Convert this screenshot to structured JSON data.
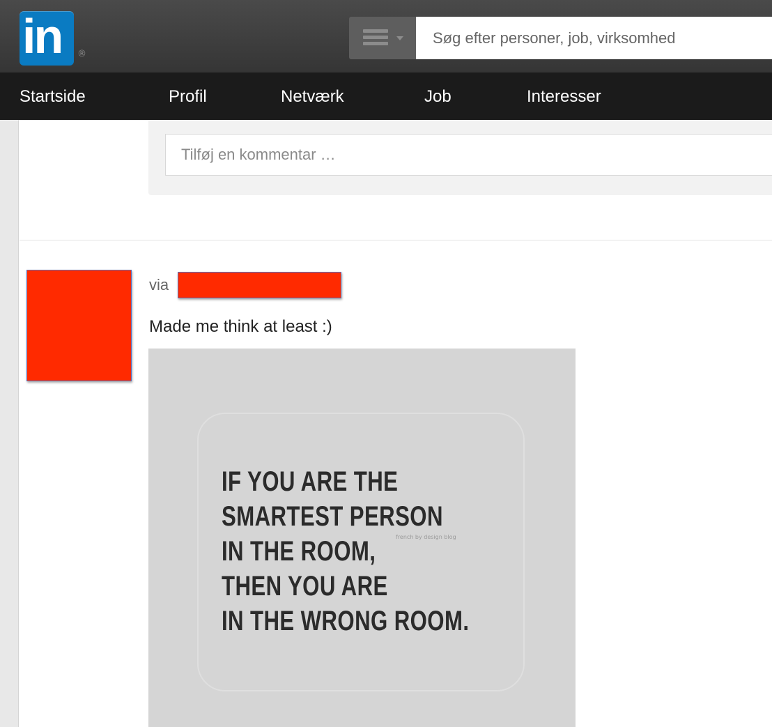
{
  "header": {
    "logo_text": "in",
    "logo_registered": "®",
    "search_placeholder": "Søg efter personer, job, virksomhed"
  },
  "nav": {
    "items": [
      {
        "label": "Startside"
      },
      {
        "label": "Profil"
      },
      {
        "label": "Netværk"
      },
      {
        "label": "Job"
      },
      {
        "label": "Interesser"
      }
    ]
  },
  "comment": {
    "placeholder": "Tilføj en kommentar …"
  },
  "post": {
    "via_label": "via",
    "text": "Made me think at least :)",
    "image": {
      "quote_lines": [
        "IF YOU ARE THE",
        "SMARTEST PERSON",
        "IN THE ROOM,",
        "THEN YOU ARE",
        "IN THE WRONG ROOM."
      ],
      "watermark": "french by design blog"
    }
  },
  "colors": {
    "linkedin_blue": "#0a7bc2",
    "redaction": "#ff2a00",
    "topbar": "#3d3d3d",
    "navbar": "#1b1b1b"
  }
}
